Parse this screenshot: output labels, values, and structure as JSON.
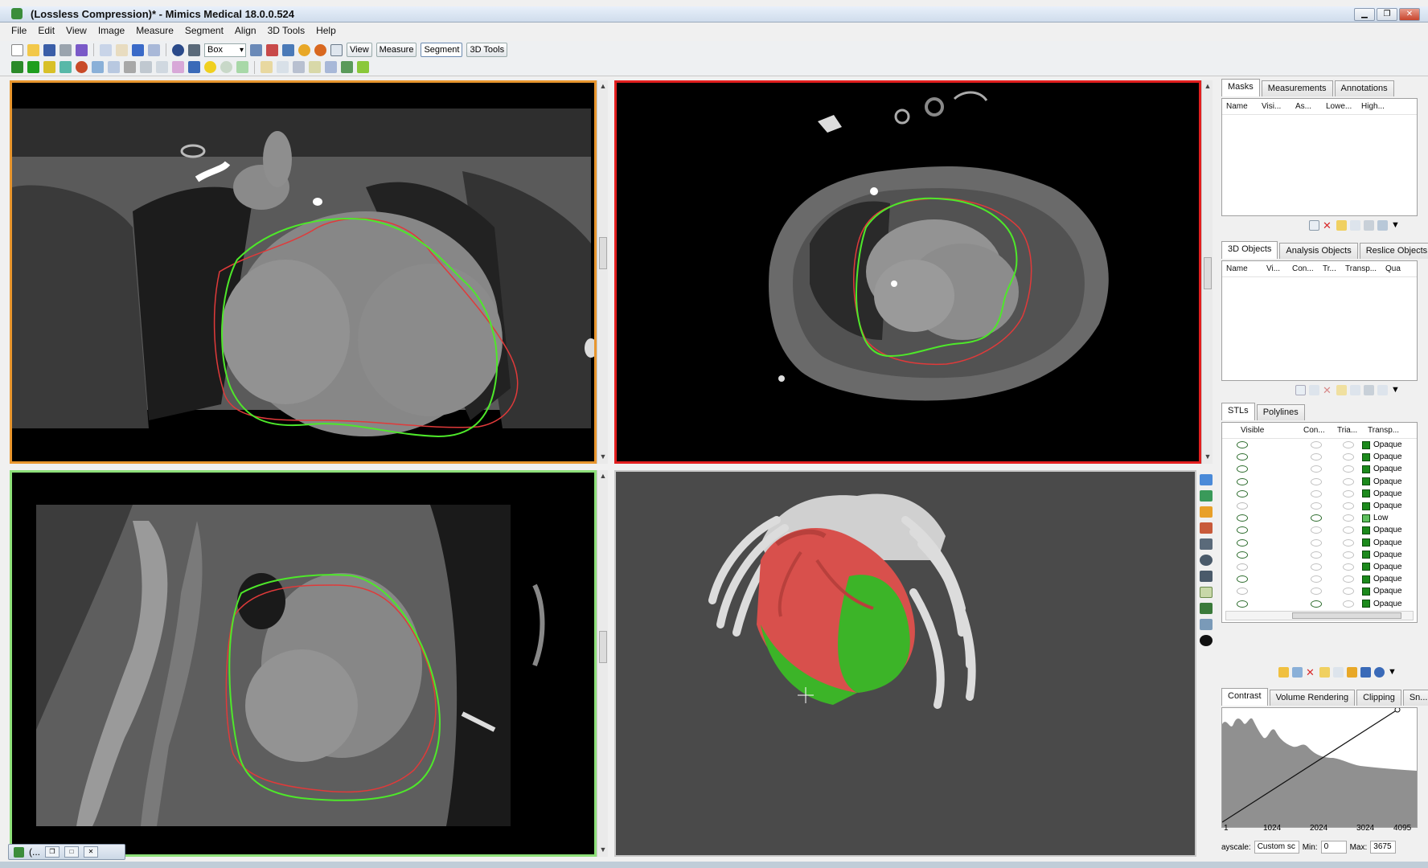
{
  "window": {
    "title": "(Lossless Compression)* - Mimics Medical 18.0.0.524",
    "min_icon": "minimize-icon",
    "max_icon": "maximize-icon",
    "close_icon": "close-icon"
  },
  "menu": [
    "File",
    "Edit",
    "View",
    "Image",
    "Measure",
    "Segment",
    "Align",
    "3D Tools",
    "Help"
  ],
  "toolbar": {
    "tool_select_value": "Box",
    "tabs": [
      "View",
      "Measure",
      "Segment",
      "3D Tools"
    ],
    "active_tab": "Segment"
  },
  "panels": {
    "masks": {
      "tabs": [
        "Masks",
        "Measurements",
        "Annotations"
      ],
      "columns": [
        "Name",
        "Visi...",
        "As...",
        "Lowe...",
        "High..."
      ]
    },
    "objects": {
      "tabs": [
        "3D Objects",
        "Analysis Objects",
        "Reslice Objects"
      ],
      "columns": [
        "Name",
        "Vi...",
        "Con...",
        "Tr...",
        "Transp...",
        "Qua"
      ]
    },
    "stls": {
      "tabs": [
        "STLs",
        "Polylines"
      ],
      "columns": [
        "Visible",
        "Con...",
        "Tria...",
        "Transp..."
      ],
      "rows": [
        {
          "visible": true,
          "contour": false,
          "transparency": "Opaque"
        },
        {
          "visible": true,
          "contour": false,
          "transparency": "Opaque"
        },
        {
          "visible": true,
          "contour": false,
          "transparency": "Opaque"
        },
        {
          "visible": true,
          "contour": false,
          "transparency": "Opaque"
        },
        {
          "visible": true,
          "contour": false,
          "transparency": "Opaque"
        },
        {
          "visible": false,
          "contour": false,
          "transparency": "Opaque"
        },
        {
          "visible": true,
          "contour": true,
          "transparency": "Low"
        },
        {
          "visible": true,
          "contour": false,
          "transparency": "Opaque"
        },
        {
          "visible": true,
          "contour": false,
          "transparency": "Opaque"
        },
        {
          "visible": true,
          "contour": false,
          "transparency": "Opaque"
        },
        {
          "visible": false,
          "contour": false,
          "transparency": "Opaque"
        },
        {
          "visible": true,
          "contour": false,
          "transparency": "Opaque"
        },
        {
          "visible": false,
          "contour": false,
          "transparency": "Opaque"
        },
        {
          "visible": true,
          "contour": true,
          "transparency": "Opaque"
        }
      ]
    },
    "contrast": {
      "tabs": [
        "Contrast",
        "Volume Rendering",
        "Clipping",
        "Sn..."
      ],
      "axis_labels": [
        "1",
        "1024",
        "2024",
        "3024",
        "4095"
      ],
      "grayscale_label": "ayscale:",
      "grayscale_value": "Custom sc",
      "min_label": "Min:",
      "min_value": "0",
      "max_label": "Max:",
      "max_value": "3675"
    }
  },
  "minimized_window": {
    "label": "(..."
  },
  "colors": {
    "coronal_border": "#e8962e",
    "axial_border": "#e21e1e",
    "sagittal_border": "#8ee07a",
    "contour_green": "#4ee82a",
    "contour_red": "#e03a3a",
    "heart_red": "#d8504c",
    "mask_green": "#3cb428"
  }
}
